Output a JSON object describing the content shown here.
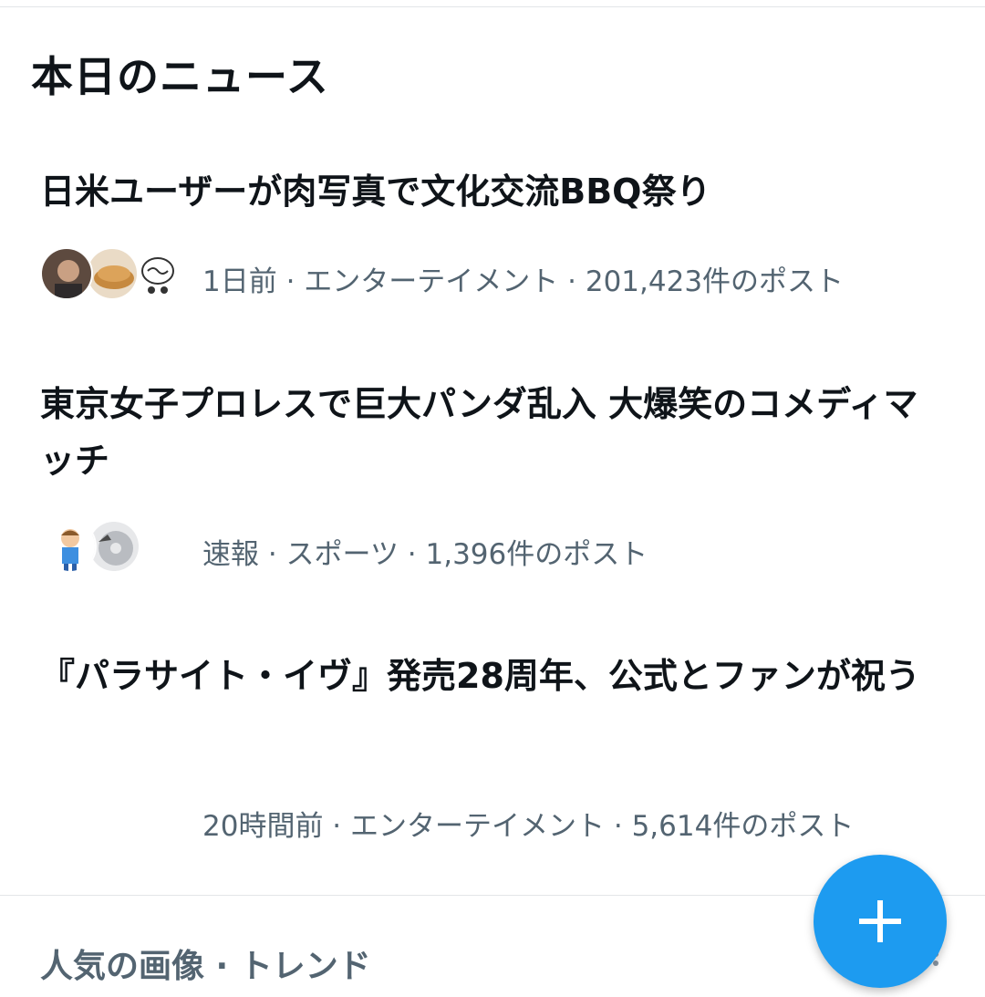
{
  "section": {
    "title": "本日のニュース"
  },
  "news": [
    {
      "headline": "日米ユーザーが肉写真で文化交流BBQ祭り",
      "meta": "1日前 · エンターテイメント · 201,423件のポスト",
      "avatars": [
        "person-avatar",
        "pancake-avatar",
        "brain-avatar"
      ]
    },
    {
      "headline": "東京女子プロレスで巨大パンダ乱入 大爆笑のコメディマッチ",
      "meta": "速報 · スポーツ · 1,396件のポスト",
      "avatars": [
        "cartoon-boy-avatar",
        "disc-avatar"
      ]
    },
    {
      "headline": "『パラサイト・イヴ』発売28周年、公式とファンが祝う",
      "meta": "20時間前 · エンターテイメント · 5,614件のポスト"
    }
  ],
  "trends": {
    "title": "人気の画像 · トレンド"
  },
  "colors": {
    "accent": "#1d9bf0",
    "meta_text": "#536471",
    "primary_text": "#0f1419"
  },
  "fab": {
    "icon": "plus-icon"
  }
}
